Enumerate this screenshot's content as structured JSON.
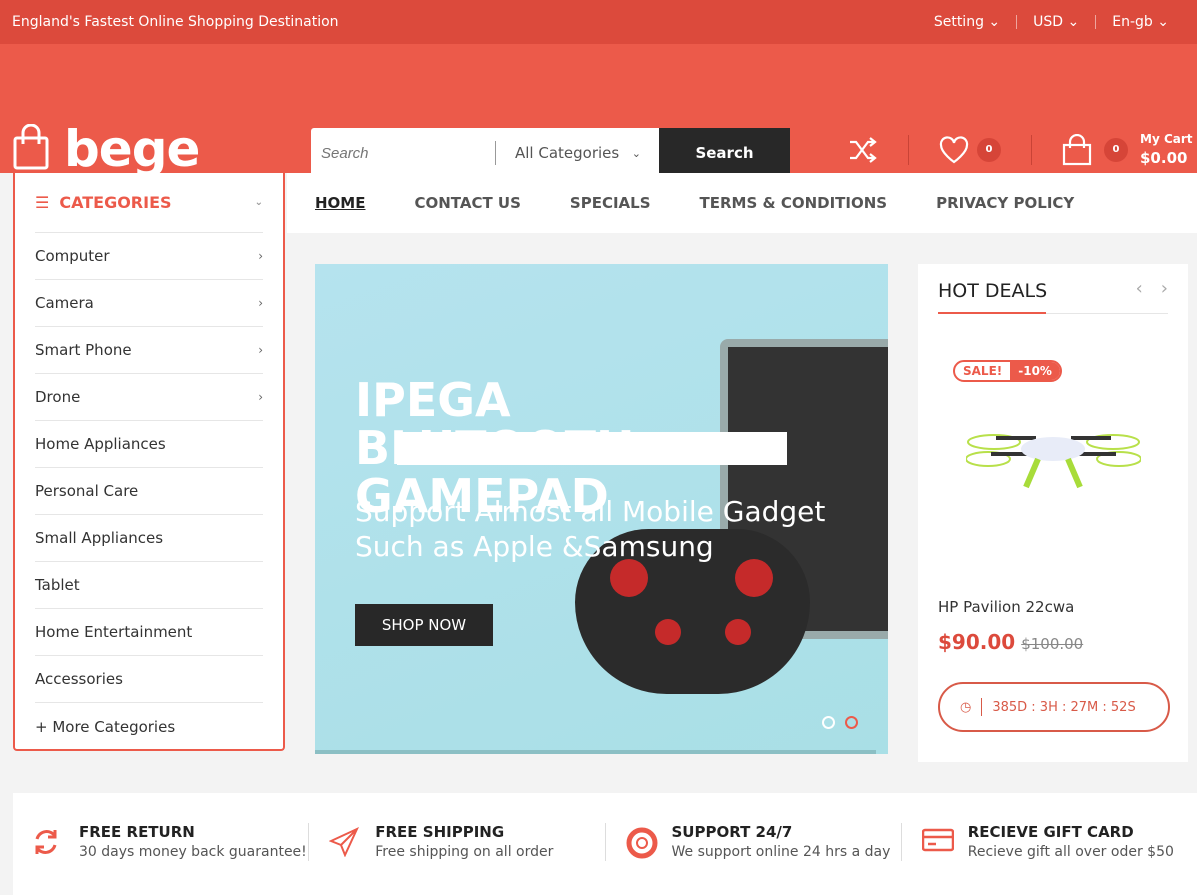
{
  "topbar": {
    "tagline": "England's Fastest Online Shopping Destination",
    "setting": "Setting",
    "currency": "USD",
    "language": "En-gb"
  },
  "header": {
    "logo": "bege",
    "search_placeholder": "Search",
    "category": "All Categories",
    "search_button": "Search",
    "wishlist_count": "0",
    "cart_count": "0",
    "cart_label": "My Cart",
    "cart_total": "$0.00"
  },
  "sidebar": {
    "title": "CATEGORIES",
    "items": [
      {
        "label": "Computer",
        "arrow": true
      },
      {
        "label": "Camera",
        "arrow": true
      },
      {
        "label": "Smart Phone",
        "arrow": true
      },
      {
        "label": "Drone",
        "arrow": true
      },
      {
        "label": "Home Appliances"
      },
      {
        "label": "Personal Care"
      },
      {
        "label": "Small Appliances"
      },
      {
        "label": "Tablet"
      },
      {
        "label": "Home Entertainment"
      },
      {
        "label": "Accessories"
      },
      {
        "label": "+ More Categories"
      }
    ]
  },
  "nav": [
    "HOME",
    "CONTACT US",
    "SPECIALS",
    "TERMS & CONDITIONS",
    "PRIVACY POLICY"
  ],
  "banner": {
    "title": "IPEGA BLUTOOTH GAMEPAD",
    "subtitle": "Support Almost all Mobile Gadget Such as Apple &Samsung",
    "button": "SHOP NOW",
    "slides": 2,
    "active_slide": 2
  },
  "deals": {
    "title": "HOT DEALS",
    "sale": "SALE!",
    "discount": "-10%",
    "product": "HP Pavilion 22cwa",
    "price": "$90.00",
    "old_price": "$100.00",
    "countdown": "385D : 3H : 27M : 52S"
  },
  "features": [
    {
      "icon": "return-icon",
      "title": "FREE RETURN",
      "text": "30 days money back guarantee!"
    },
    {
      "icon": "paper-plane-icon",
      "title": "FREE SHIPPING",
      "text": "Free shipping on all order"
    },
    {
      "icon": "lifebuoy-icon",
      "title": "SUPPORT 24/7",
      "text": "We support online 24 hrs a day"
    },
    {
      "icon": "gift-card-icon",
      "title": "RECIEVE GIFT CARD",
      "text": "Recieve gift all over oder $50"
    }
  ],
  "colors": {
    "accent": "#ec5a4a",
    "topbar": "#dc4a3c",
    "dark": "#282828"
  }
}
